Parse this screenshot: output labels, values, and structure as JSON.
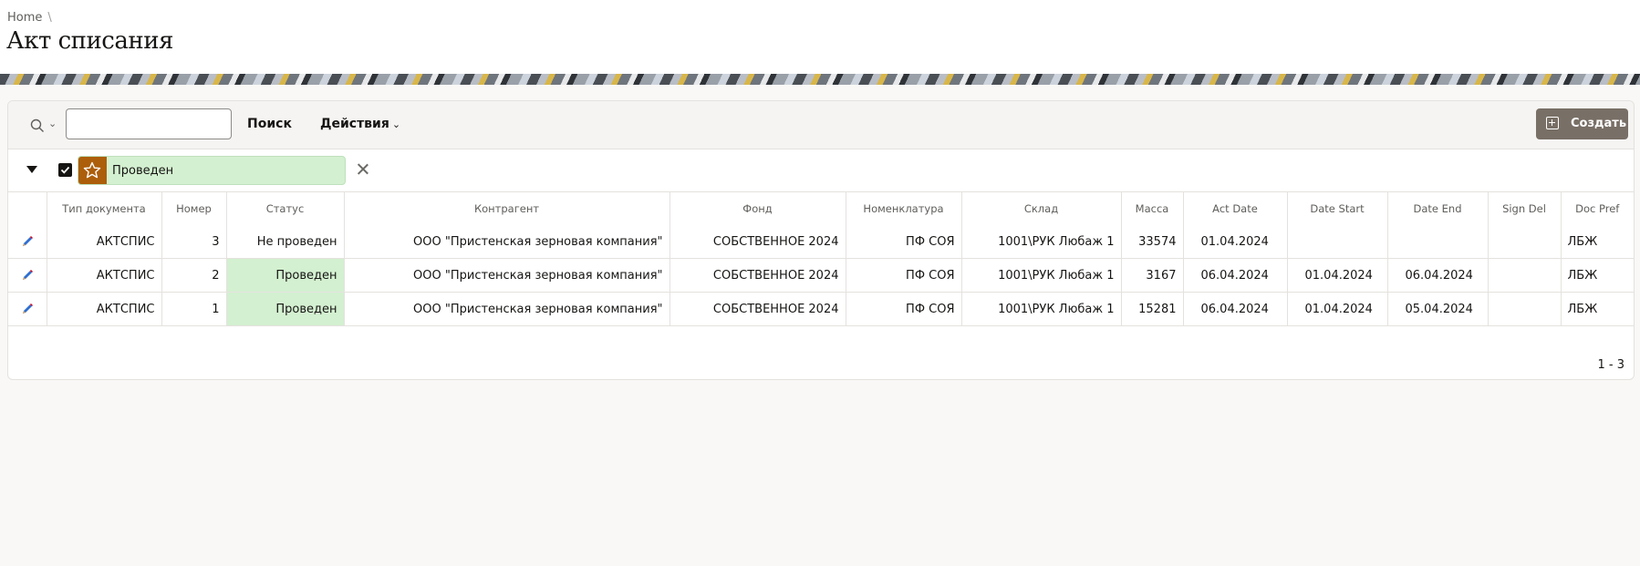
{
  "breadcrumb": {
    "home": "Home",
    "separator": "\\"
  },
  "page": {
    "title": "Акт списания"
  },
  "toolbar": {
    "search_icon": "search-icon",
    "search_value": "",
    "go_label": "Поиск",
    "actions_label": "Действия",
    "create_label": "Создать"
  },
  "filter": {
    "label": "Проведен",
    "checked": true,
    "icon": "star-icon"
  },
  "colors": {
    "accent": "#786f66",
    "filter_icon_bg": "#ad5e0a",
    "highlight": "#d3f0d0"
  },
  "table": {
    "columns": [
      "",
      "Тип документа",
      "Номер",
      "Статус",
      "Контрагент",
      "Фонд",
      "Номенклатура",
      "Склад",
      "Масса",
      "Act Date",
      "Date Start",
      "Date End",
      "Sign Del",
      "Doc Pref"
    ],
    "rows": [
      {
        "type": "АКТСПИС",
        "number": "3",
        "status": "Не проведен",
        "counterparty": "ООО \"Пристенская зерновая компания\"",
        "fund": "СОБСТВЕННОЕ 2024",
        "nomenclature": "ПФ СОЯ",
        "warehouse": "1001\\РУК Любаж 1",
        "mass": "33574",
        "act_date": "01.04.2024",
        "date_start": "",
        "date_end": "",
        "sign_del": "",
        "doc_pref": "ЛБЖ"
      },
      {
        "type": "АКТСПИС",
        "number": "2",
        "status": "Проведен",
        "counterparty": "ООО \"Пристенская зерновая компания\"",
        "fund": "СОБСТВЕННОЕ 2024",
        "nomenclature": "ПФ СОЯ",
        "warehouse": "1001\\РУК Любаж 1",
        "mass": "3167",
        "act_date": "06.04.2024",
        "date_start": "01.04.2024",
        "date_end": "06.04.2024",
        "sign_del": "",
        "doc_pref": "ЛБЖ"
      },
      {
        "type": "АКТСПИС",
        "number": "1",
        "status": "Проведен",
        "counterparty": "ООО \"Пристенская зерновая компания\"",
        "fund": "СОБСТВЕННОЕ 2024",
        "nomenclature": "ПФ СОЯ",
        "warehouse": "1001\\РУК Любаж 1",
        "mass": "15281",
        "act_date": "06.04.2024",
        "date_start": "01.04.2024",
        "date_end": "05.04.2024",
        "sign_del": "",
        "doc_pref": "ЛБЖ"
      }
    ]
  },
  "pagination": {
    "label": "1 - 3"
  }
}
